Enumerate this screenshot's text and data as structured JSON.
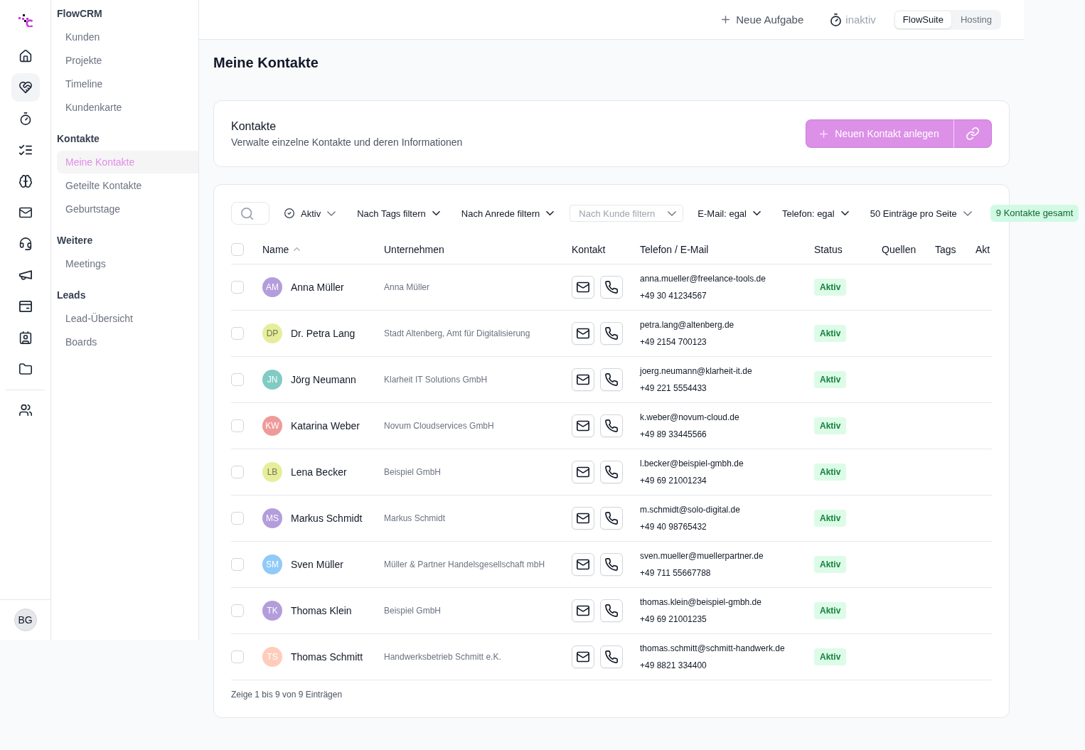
{
  "rail": {
    "items": [
      {
        "selected": false
      },
      {
        "selected": true
      },
      {
        "selected": false
      },
      {
        "selected": false
      },
      {
        "selected": false
      },
      {
        "selected": false
      },
      {
        "selected": false
      },
      {
        "selected": false
      },
      {
        "selected": false
      },
      {
        "selected": false
      },
      {
        "selected": false
      }
    ],
    "extra_items": [
      {
        "selected": false
      }
    ],
    "user_initials": "BG"
  },
  "sidebar": {
    "sections": [
      {
        "title": "FlowCRM",
        "items": [
          {
            "label": "Kunden",
            "selected": false
          },
          {
            "label": "Projekte",
            "selected": false
          },
          {
            "label": "Timeline",
            "selected": false
          },
          {
            "label": "Kundenkarte",
            "selected": false
          }
        ]
      },
      {
        "title": "Kontakte",
        "items": [
          {
            "label": "Meine Kontakte",
            "selected": true
          },
          {
            "label": "Geteilte Kontakte",
            "selected": false
          },
          {
            "label": "Geburtstage",
            "selected": false
          }
        ]
      },
      {
        "title": "Weitere",
        "items": [
          {
            "label": "Meetings",
            "selected": false
          }
        ]
      },
      {
        "title": "Leads",
        "items": [
          {
            "label": "Lead-Übersicht",
            "selected": false
          },
          {
            "label": "Boards",
            "selected": false
          }
        ]
      }
    ]
  },
  "top_bar": {
    "new_task": "Neue Aufgabe",
    "timer_status": "inaktiv",
    "workspace_tabs": [
      {
        "label": "FlowSuite",
        "selected": true
      },
      {
        "label": "Hosting",
        "selected": false
      }
    ]
  },
  "page_title": "Meine Kontakte",
  "header_card": {
    "title": "Kontakte",
    "subtitle": "Verwalte einzelne Kontakte und deren Informationen",
    "primary_button": "Neuen Kontakt anlegen"
  },
  "filters": {
    "items": [
      {
        "kind": "status",
        "label": "Aktiv"
      },
      {
        "kind": "dropdown",
        "label": "Nach Tags filtern"
      },
      {
        "kind": "dropdown",
        "label": "Nach Anrede filtern"
      },
      {
        "kind": "select",
        "placeholder": "Nach Kunde filtern"
      },
      {
        "kind": "dropdown",
        "label": "E-Mail: egal"
      },
      {
        "kind": "dropdown",
        "label": "Telefon: egal"
      },
      {
        "kind": "page_size",
        "label": "50 Einträge pro Seite"
      }
    ],
    "total": "9 Kontakte gesamt"
  },
  "table": {
    "select_all_checked": false,
    "columns": [
      {
        "label": "Name",
        "sorted": true
      },
      {
        "label": "Unternehmen",
        "sorted": false
      },
      {
        "label": "Kontakt",
        "sorted": false
      },
      {
        "label": "Telefon / E-Mail",
        "sorted": false
      },
      {
        "label": "Status",
        "sorted": false
      },
      {
        "label": "Quellen",
        "sorted": false
      },
      {
        "label": "Tags",
        "sorted": false
      },
      {
        "label": "Akt",
        "sorted": false
      }
    ],
    "rows": [
      {
        "checked": false,
        "initials": "AM",
        "color": "#b39ddb",
        "name": "Anna Müller",
        "company": "Anna Müller",
        "email": "anna.mueller@freelance-tools.de",
        "phone": "+49 30 41234567",
        "status": "Aktiv"
      },
      {
        "checked": false,
        "initials": "DP",
        "color": "#e6ee9c",
        "name": "Dr. Petra Lang",
        "company": "Stadt Altenberg, Amt für Digitalisierung",
        "email": "petra.lang@altenberg.de",
        "phone": "+49 2154 700123",
        "status": "Aktiv"
      },
      {
        "checked": false,
        "initials": "JN",
        "color": "#80cbc4",
        "name": "Jörg Neumann",
        "company": "Klarheit IT Solutions GmbH",
        "email": "joerg.neumann@klarheit-it.de",
        "phone": "+49 221 5554433",
        "status": "Aktiv"
      },
      {
        "checked": false,
        "initials": "KW",
        "color": "#ef9a9a",
        "name": "Katarina Weber",
        "company": "Novum Cloudservices GmbH",
        "email": "k.weber@novum-cloud.de",
        "phone": "+49 89 33445566",
        "status": "Aktiv"
      },
      {
        "checked": false,
        "initials": "LB",
        "color": "#e6ee9c",
        "name": "Lena Becker",
        "company": "Beispiel GmbH",
        "email": "l.becker@beispiel-gmbh.de",
        "phone": "+49 69 21001234",
        "status": "Aktiv"
      },
      {
        "checked": false,
        "initials": "MS",
        "color": "#b39ddb",
        "name": "Markus Schmidt",
        "company": "Markus Schmidt",
        "email": "m.schmidt@solo-digital.de",
        "phone": "+49 40 98765432",
        "status": "Aktiv"
      },
      {
        "checked": false,
        "initials": "SM",
        "color": "#90caf9",
        "name": "Sven Müller",
        "company": "Müller & Partner Handelsgesellschaft mbH",
        "email": "sven.mueller@muellerpartner.de",
        "phone": "+49 711 55667788",
        "status": "Aktiv"
      },
      {
        "checked": false,
        "initials": "TK",
        "color": "#b39ddb",
        "name": "Thomas Klein",
        "company": "Beispiel GmbH",
        "email": "thomas.klein@beispiel-gmbh.de",
        "phone": "+49 69 21001235",
        "status": "Aktiv"
      },
      {
        "checked": false,
        "initials": "TS",
        "color": "#ffccbc",
        "name": "Thomas Schmitt",
        "company": "Handwerksbetrieb Schmitt e.K.",
        "email": "thomas.schmitt@schmitt-handwerk.de",
        "phone": "+49 8821 334400",
        "status": "Aktiv"
      }
    ],
    "footer": "Zeige 1 bis 9 von 9 Einträgen"
  }
}
